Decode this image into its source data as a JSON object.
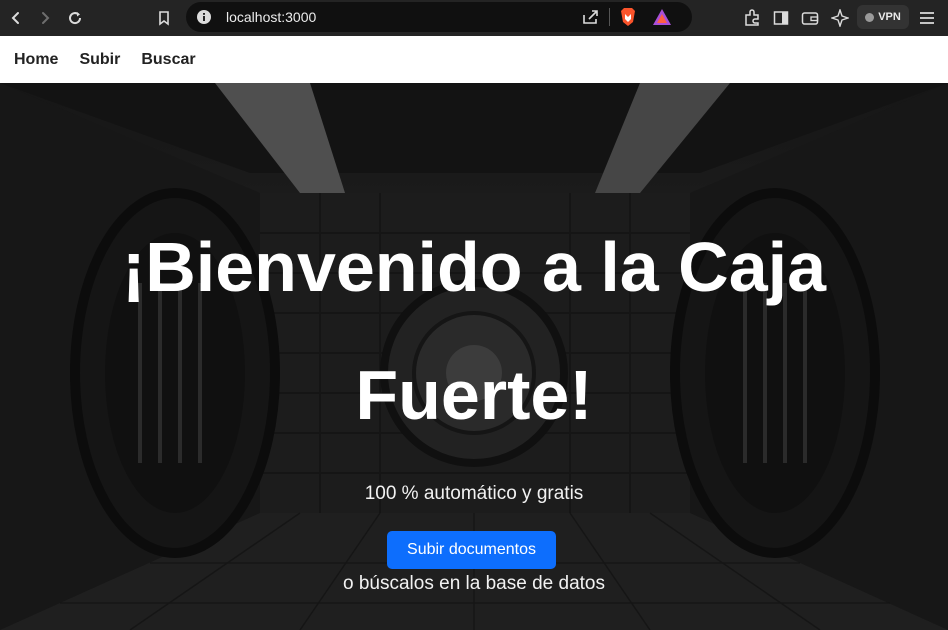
{
  "browser": {
    "url": "localhost:3000",
    "vpn_label": "VPN"
  },
  "nav": {
    "items": [
      {
        "label": "Home"
      },
      {
        "label": "Subir"
      },
      {
        "label": "Buscar"
      }
    ]
  },
  "hero": {
    "title_line1": "¡Bienvenido a la Caja",
    "title_line2": "Fuerte!",
    "subtitle": "100 % automático y gratis",
    "cta_label": "Subir documentos",
    "alt_text": "o búscalos en la base de datos"
  },
  "colors": {
    "accent": "#0d6efd",
    "chrome_bg": "#242424",
    "nav_bg": "#ffffff"
  }
}
